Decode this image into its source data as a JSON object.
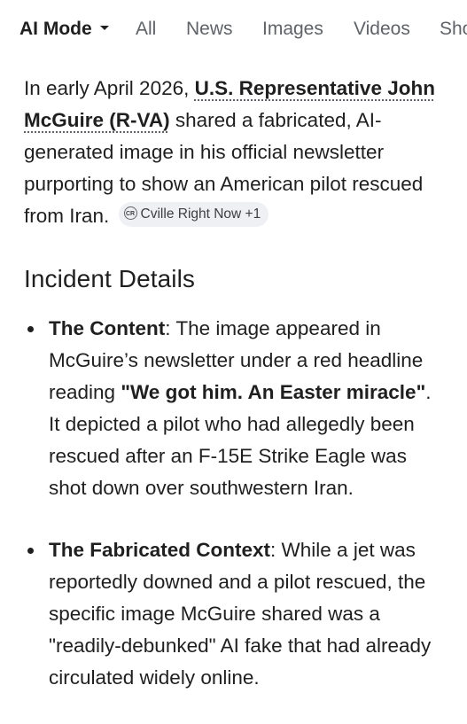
{
  "tabs": {
    "ai_mode": "AI Mode",
    "all": "All",
    "news": "News",
    "images": "Images",
    "videos": "Videos",
    "shopping_partial": "Sho"
  },
  "intro": {
    "text_before": "In early April 2026, ",
    "bold_name": "U.S. Representative John McGuire (R-VA)",
    "text_after": " shared a fabricated, AI-generated image in his official newsletter purporting to show an American pilot rescued from Iran.",
    "source_chip": {
      "icon": "cville-logo-icon",
      "icon_text": "CR",
      "label": "Cville Right Now +1"
    }
  },
  "section_heading": "Incident Details",
  "details": [
    {
      "title": "The Content",
      "text_before": ": The image appeared in McGuire’s newsletter under a red headline reading ",
      "bold_quote": "\"We got him. An Easter miracle\"",
      "text_after": ". It depicted a pilot who had allegedly been rescued after an F-15E Strike Eagle was shot down over southwestern Iran."
    },
    {
      "title": "The Fabricated Context",
      "text_before": ": While a jet was reportedly downed and a pilot rescued, the specific image McGuire shared was a \"readily-debunked\" AI fake that had already circulated widely online.",
      "bold_quote": "",
      "text_after": ""
    }
  ],
  "colors": {
    "text": "#1f1f1f",
    "muted": "#5f6368",
    "chip_bg": "#eef0f4"
  }
}
